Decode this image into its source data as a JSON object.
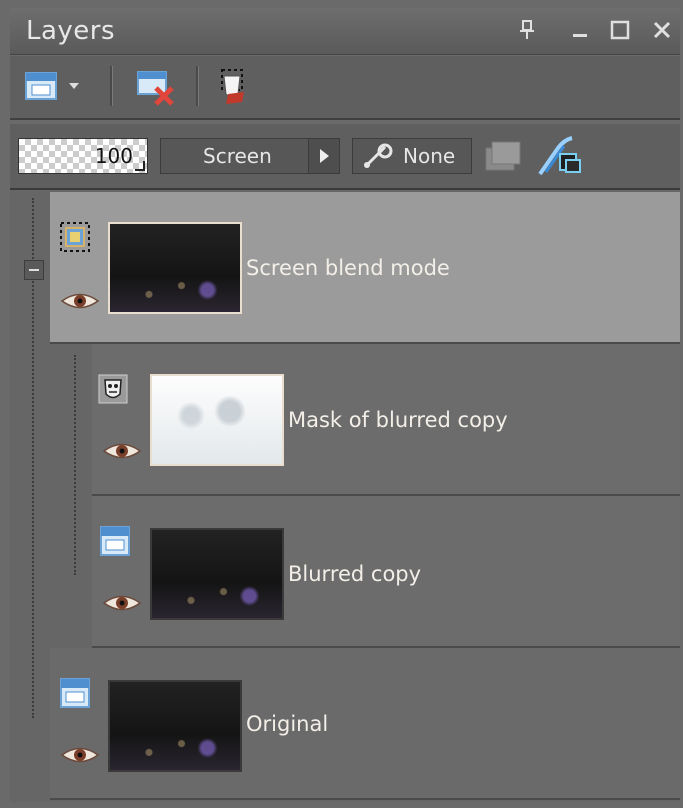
{
  "panel": {
    "title": "Layers"
  },
  "toolbar": {
    "opacity_value": "100",
    "blend_mode": "Screen",
    "link_label": "None"
  },
  "layers": [
    {
      "name": "Screen blend mode",
      "type": "raster",
      "selected": true,
      "visible": true
    },
    {
      "name": "Mask of blurred copy",
      "type": "mask",
      "selected": false,
      "visible": true
    },
    {
      "name": "Blurred copy",
      "type": "raster",
      "selected": false,
      "visible": true
    },
    {
      "name": "Original",
      "type": "raster",
      "selected": false,
      "visible": true
    }
  ],
  "colors": {
    "panel_bg": "#6a6a6a",
    "selected_row": "#9b9b9b",
    "text": "#f2f2f2"
  }
}
